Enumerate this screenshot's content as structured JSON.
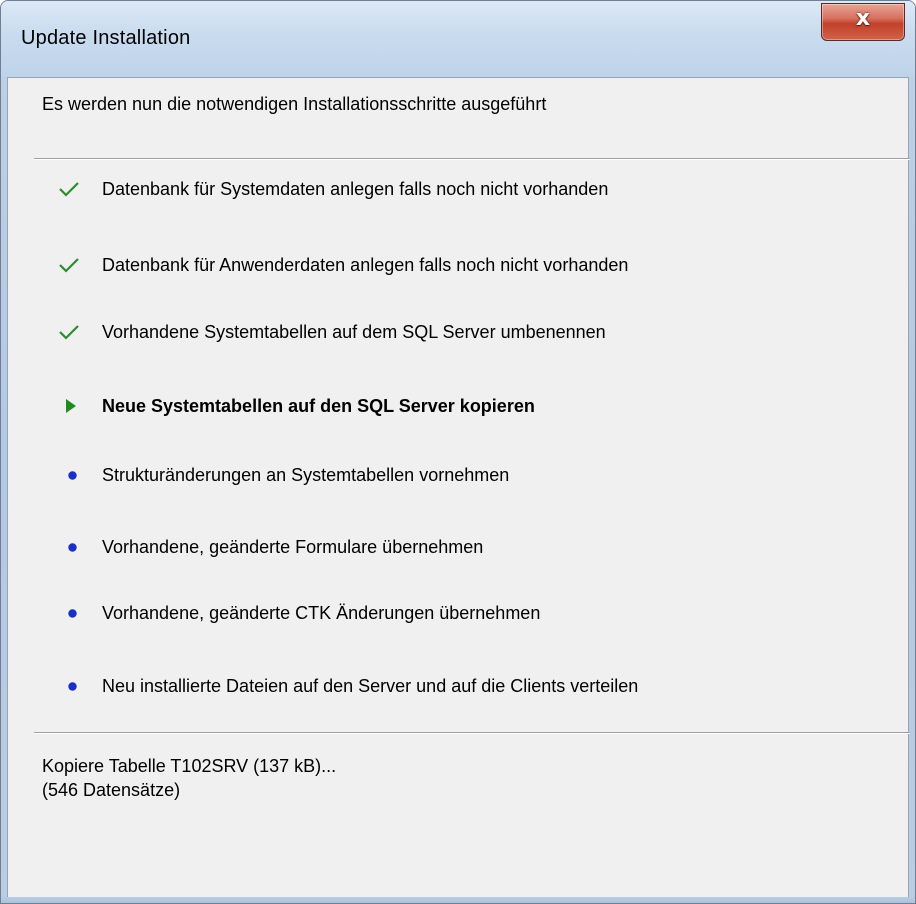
{
  "window": {
    "title": "Update Installation",
    "close_label": "x"
  },
  "header": {
    "text": "Es werden nun die notwendigen Installationsschritte ausgeführt"
  },
  "steps": [
    {
      "label": "Datenbank für Systemdaten anlegen falls noch nicht vorhanden",
      "status": "done",
      "icon": "check-icon"
    },
    {
      "label": "Datenbank für Anwenderdaten anlegen falls noch nicht vorhanden",
      "status": "done",
      "icon": "check-icon"
    },
    {
      "label": "Vorhandene Systemtabellen auf dem SQL Server umbenennen",
      "status": "done",
      "icon": "check-icon"
    },
    {
      "label": "Neue Systemtabellen auf den SQL Server kopieren",
      "status": "active",
      "icon": "arrow-icon"
    },
    {
      "label": "Strukturänderungen an Systemtabellen vornehmen",
      "status": "pending",
      "icon": "bullet-icon"
    },
    {
      "label": "Vorhandene, geänderte Formulare übernehmen",
      "status": "pending",
      "icon": "bullet-icon"
    },
    {
      "label": "Vorhandene, geänderte CTK Änderungen übernehmen",
      "status": "pending",
      "icon": "bullet-icon"
    },
    {
      "label": "Neu installierte Dateien auf den Server und auf die Clients verteilen",
      "status": "pending",
      "icon": "bullet-icon"
    }
  ],
  "status": {
    "line1": "Kopiere Tabelle T102SRV (137 kB)...",
    "line2": "(546 Datensätze)"
  },
  "colors": {
    "check": "#2e8b2e",
    "arrow": "#1f8a1f",
    "bullet": "#1a2fc4",
    "close_button": "#c2412a"
  }
}
